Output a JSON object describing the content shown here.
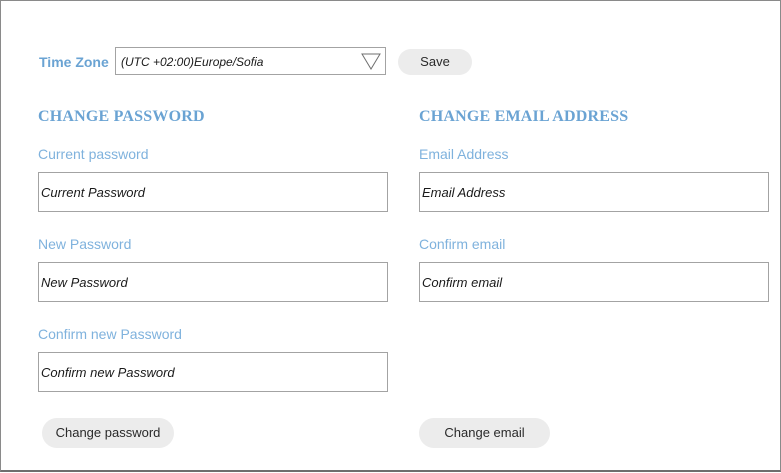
{
  "timezone": {
    "label": "Time Zone",
    "selected": "(UTC +02:00)Europe/Sofia",
    "save_label": "Save"
  },
  "password_section": {
    "heading": "CHANGE PASSWORD",
    "fields": [
      {
        "label": "Current password",
        "placeholder": "Current Password"
      },
      {
        "label": "New Password",
        "placeholder": "New Password"
      },
      {
        "label": "Confirm new Password",
        "placeholder": "Confirm new Password"
      }
    ],
    "button_label": "Change password"
  },
  "email_section": {
    "heading": "CHANGE EMAIL ADDRESS",
    "fields": [
      {
        "label": "Email Address",
        "placeholder": "Email Address"
      },
      {
        "label": "Confirm email",
        "placeholder": "Confirm email"
      }
    ],
    "button_label": "Change email"
  },
  "colors": {
    "accent": "#6aa3d3",
    "button_bg": "#ececec",
    "border": "#a3a3a3"
  },
  "icons": {
    "dropdown": "triangle-down-outline-icon"
  }
}
